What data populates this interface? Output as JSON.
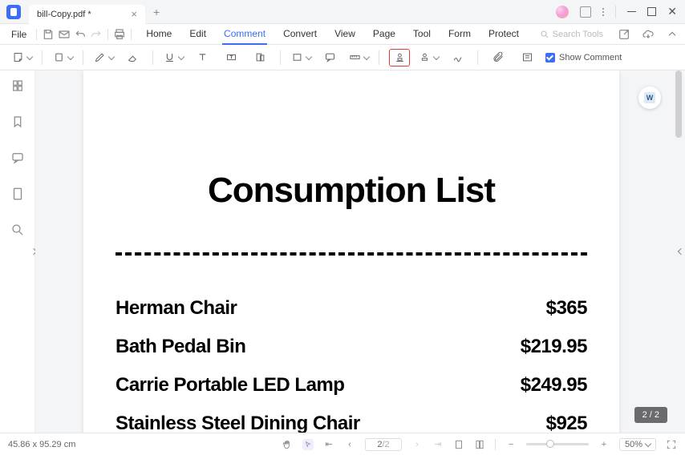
{
  "tab": {
    "title": "bill-Copy.pdf *"
  },
  "menu": {
    "file": "File",
    "items": [
      "Home",
      "Edit",
      "Comment",
      "Convert",
      "View",
      "Page",
      "Tool",
      "Form",
      "Protect"
    ],
    "active_index": 2,
    "search_placeholder": "Search Tools"
  },
  "toolbar": {
    "show_comment": "Show Comment"
  },
  "document": {
    "title": "Consumption List",
    "items": [
      {
        "name": "Herman Chair",
        "price": "$365"
      },
      {
        "name": "Bath Pedal Bin",
        "price": "$219.95"
      },
      {
        "name": "Carrie Portable LED Lamp",
        "price": "$249.95"
      },
      {
        "name": "Stainless Steel Dining Chair",
        "price": "$925"
      }
    ]
  },
  "status": {
    "cursor_pos": "45.86 x 95.29 cm",
    "page": "2",
    "page_total": "/2",
    "zoom": "50%",
    "page_badge": "2 / 2"
  }
}
